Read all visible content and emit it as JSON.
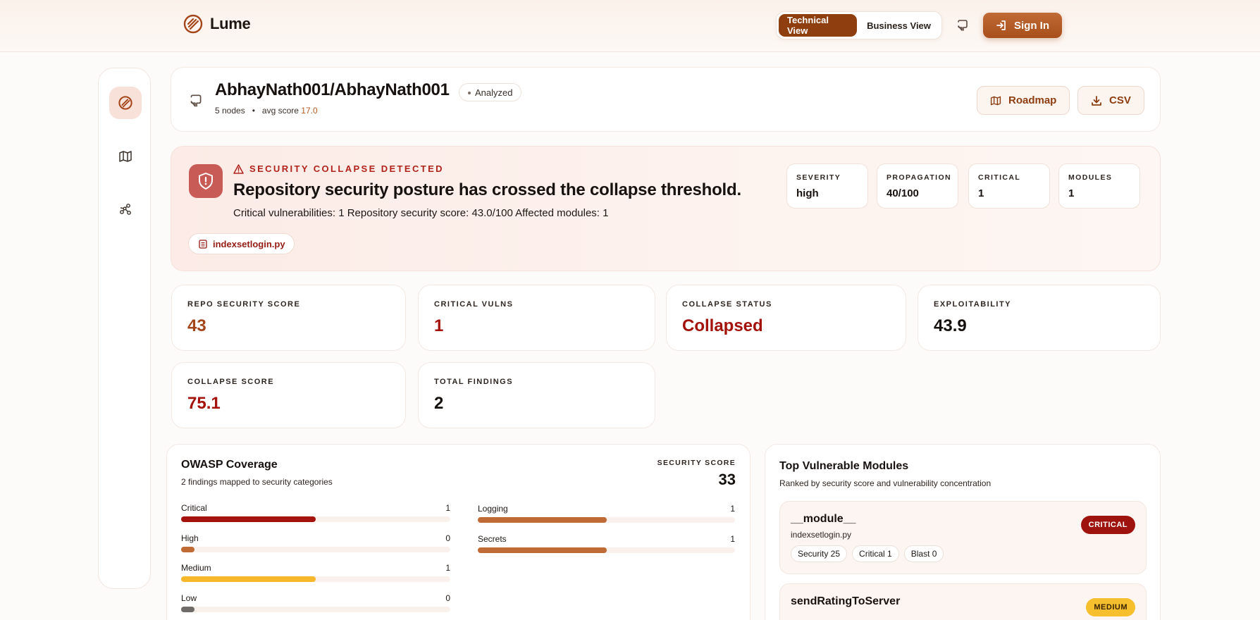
{
  "header": {
    "brand": "Lume",
    "views": [
      "Technical View",
      "Business View"
    ],
    "active_view": "Technical View",
    "signin_label": "Sign In"
  },
  "repo": {
    "title": "AbhayNath001/AbhayNath001",
    "status": "Analyzed",
    "nodes": "5 nodes",
    "sep": "•",
    "avg_label": "avg score",
    "avg_value": "17.0",
    "roadmap_label": "Roadmap",
    "csv_label": "CSV"
  },
  "alert": {
    "kicker": "SECURITY COLLAPSE DETECTED",
    "title": "Repository security posture has crossed the collapse threshold.",
    "description": "Critical vulnerabilities: 1 Repository security score: 43.0/100 Affected modules: 1",
    "file": "indexsetlogin.py",
    "stats": [
      {
        "label": "SEVERITY",
        "value": "high"
      },
      {
        "label": "PROPAGATION",
        "value": "40/100"
      },
      {
        "label": "CRITICAL",
        "value": "1"
      },
      {
        "label": "MODULES",
        "value": "1"
      }
    ]
  },
  "metrics": [
    {
      "label": "REPO SECURITY SCORE",
      "value": "43"
    },
    {
      "label": "CRITICAL VULNS",
      "value": "1"
    },
    {
      "label": "COLLAPSE STATUS",
      "value": "Collapsed"
    },
    {
      "label": "EXPLOITABILITY",
      "value": "43.9"
    },
    {
      "label": "COLLAPSE SCORE",
      "value": "75.1"
    },
    {
      "label": "TOTAL FINDINGS",
      "value": "2"
    }
  ],
  "owasp": {
    "title": "OWASP Coverage",
    "subtitle": "2 findings mapped to security categories",
    "score_label": "SECURITY SCORE",
    "score_value": "33",
    "severity_bars": [
      {
        "name": "Critical",
        "count": "1",
        "fill": 0.5,
        "color": "#a4120c"
      },
      {
        "name": "High",
        "count": "0",
        "fill": 0.05,
        "color": "#c06a35"
      },
      {
        "name": "Medium",
        "count": "1",
        "fill": 0.5,
        "color": "#f6b82a"
      },
      {
        "name": "Low",
        "count": "0",
        "fill": 0.05,
        "color": "#6e6a68"
      }
    ],
    "category_bars": [
      {
        "name": "Logging",
        "count": "1",
        "fill": 0.5,
        "color": "#c06a35"
      },
      {
        "name": "Secrets",
        "count": "1",
        "fill": 0.5,
        "color": "#c06a35"
      }
    ]
  },
  "modules": {
    "title": "Top Vulnerable Modules",
    "subtitle": "Ranked by security score and vulnerability concentration",
    "items": [
      {
        "name": "__module__",
        "file": "indexsetlogin.py",
        "tags": [
          "Security 25",
          "Critical 1",
          "Blast 0"
        ],
        "badge": "CRITICAL",
        "badge_bg": "#9e130d",
        "badge_fg": "#ffffff"
      },
      {
        "name": "sendRatingToServer",
        "badge": "MEDIUM",
        "badge_bg": "#f6bf2e",
        "badge_fg": "#3a2405"
      }
    ]
  },
  "colors": {
    "accent": "#8f3f0f",
    "danger": "#a4120c",
    "orange": "#a4461a"
  }
}
